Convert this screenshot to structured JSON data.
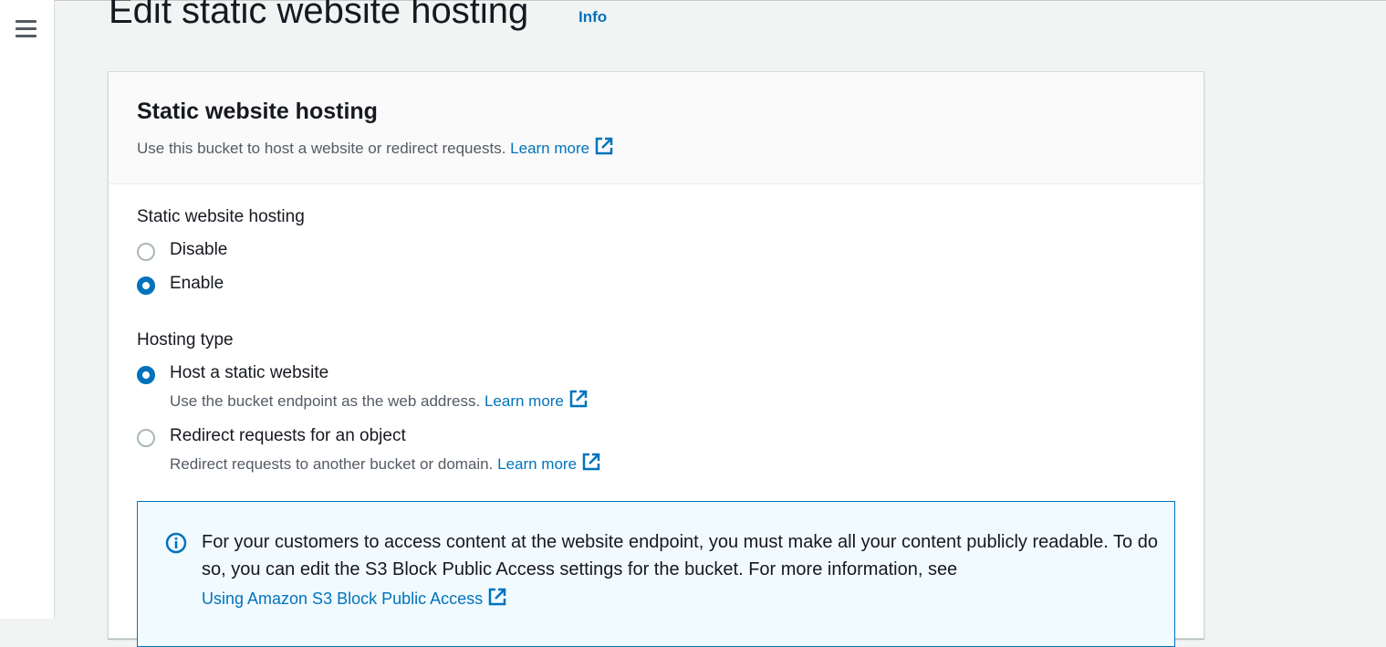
{
  "page": {
    "title": "Edit static website hosting",
    "info_link": "Info"
  },
  "panel": {
    "title": "Static website hosting",
    "description": "Use this bucket to host a website or redirect requests.",
    "learn_more": "Learn more"
  },
  "hosting_toggle": {
    "label": "Static website hosting",
    "options": [
      {
        "label": "Disable",
        "checked": false
      },
      {
        "label": "Enable",
        "checked": true
      }
    ]
  },
  "hosting_type": {
    "label": "Hosting type",
    "options": [
      {
        "label": "Host a static website",
        "description": "Use the bucket endpoint as the web address.",
        "learn_more": "Learn more",
        "checked": true
      },
      {
        "label": "Redirect requests for an object",
        "description": "Redirect requests to another bucket or domain.",
        "learn_more": "Learn more",
        "checked": false
      }
    ]
  },
  "alert": {
    "icon": "info-icon",
    "text": "For your customers to access content at the website endpoint, you must make all your content publicly readable. To do so, you can edit the S3 Block Public Access settings for the bucket. For more information, see",
    "link": "Using Amazon S3 Block Public Access"
  },
  "colors": {
    "accent": "#0073bb",
    "text": "#16191f",
    "muted": "#545b64",
    "alert_bg": "#f1faff"
  }
}
